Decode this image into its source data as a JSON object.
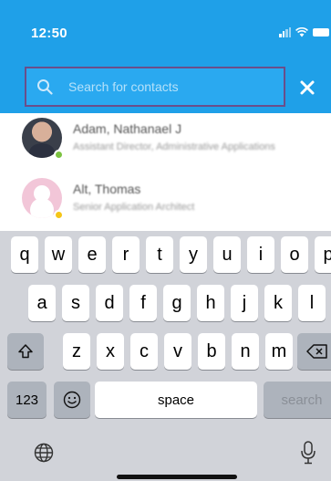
{
  "status_bar": {
    "time": "12:50"
  },
  "search": {
    "placeholder": "Search for contacts",
    "value": ""
  },
  "contacts": [
    {
      "name": "Adam, Nathanael J",
      "title": "Assistant Director, Administrative Applications",
      "presence": "available"
    },
    {
      "name": "Alt, Thomas",
      "title": "Senior Application Architect",
      "presence": "away"
    }
  ],
  "keyboard": {
    "row1": [
      "q",
      "w",
      "e",
      "r",
      "t",
      "y",
      "u",
      "i",
      "o",
      "p"
    ],
    "row2": [
      "a",
      "s",
      "d",
      "f",
      "g",
      "h",
      "j",
      "k",
      "l"
    ],
    "row3": [
      "z",
      "x",
      "c",
      "v",
      "b",
      "n",
      "m"
    ],
    "numbers_key": "123",
    "space_key": "space",
    "search_key": "search"
  },
  "colors": {
    "header": "#1fa0e8",
    "search_border": "#6a4e8a",
    "presence_available": "#7cc241",
    "presence_away": "#f5c518",
    "keyboard_bg": "#d1d3d9"
  },
  "icons": [
    "wifi-icon",
    "search-icon",
    "close-icon",
    "shift-icon",
    "backspace-icon",
    "emoji-icon",
    "globe-icon",
    "microphone-icon"
  ]
}
